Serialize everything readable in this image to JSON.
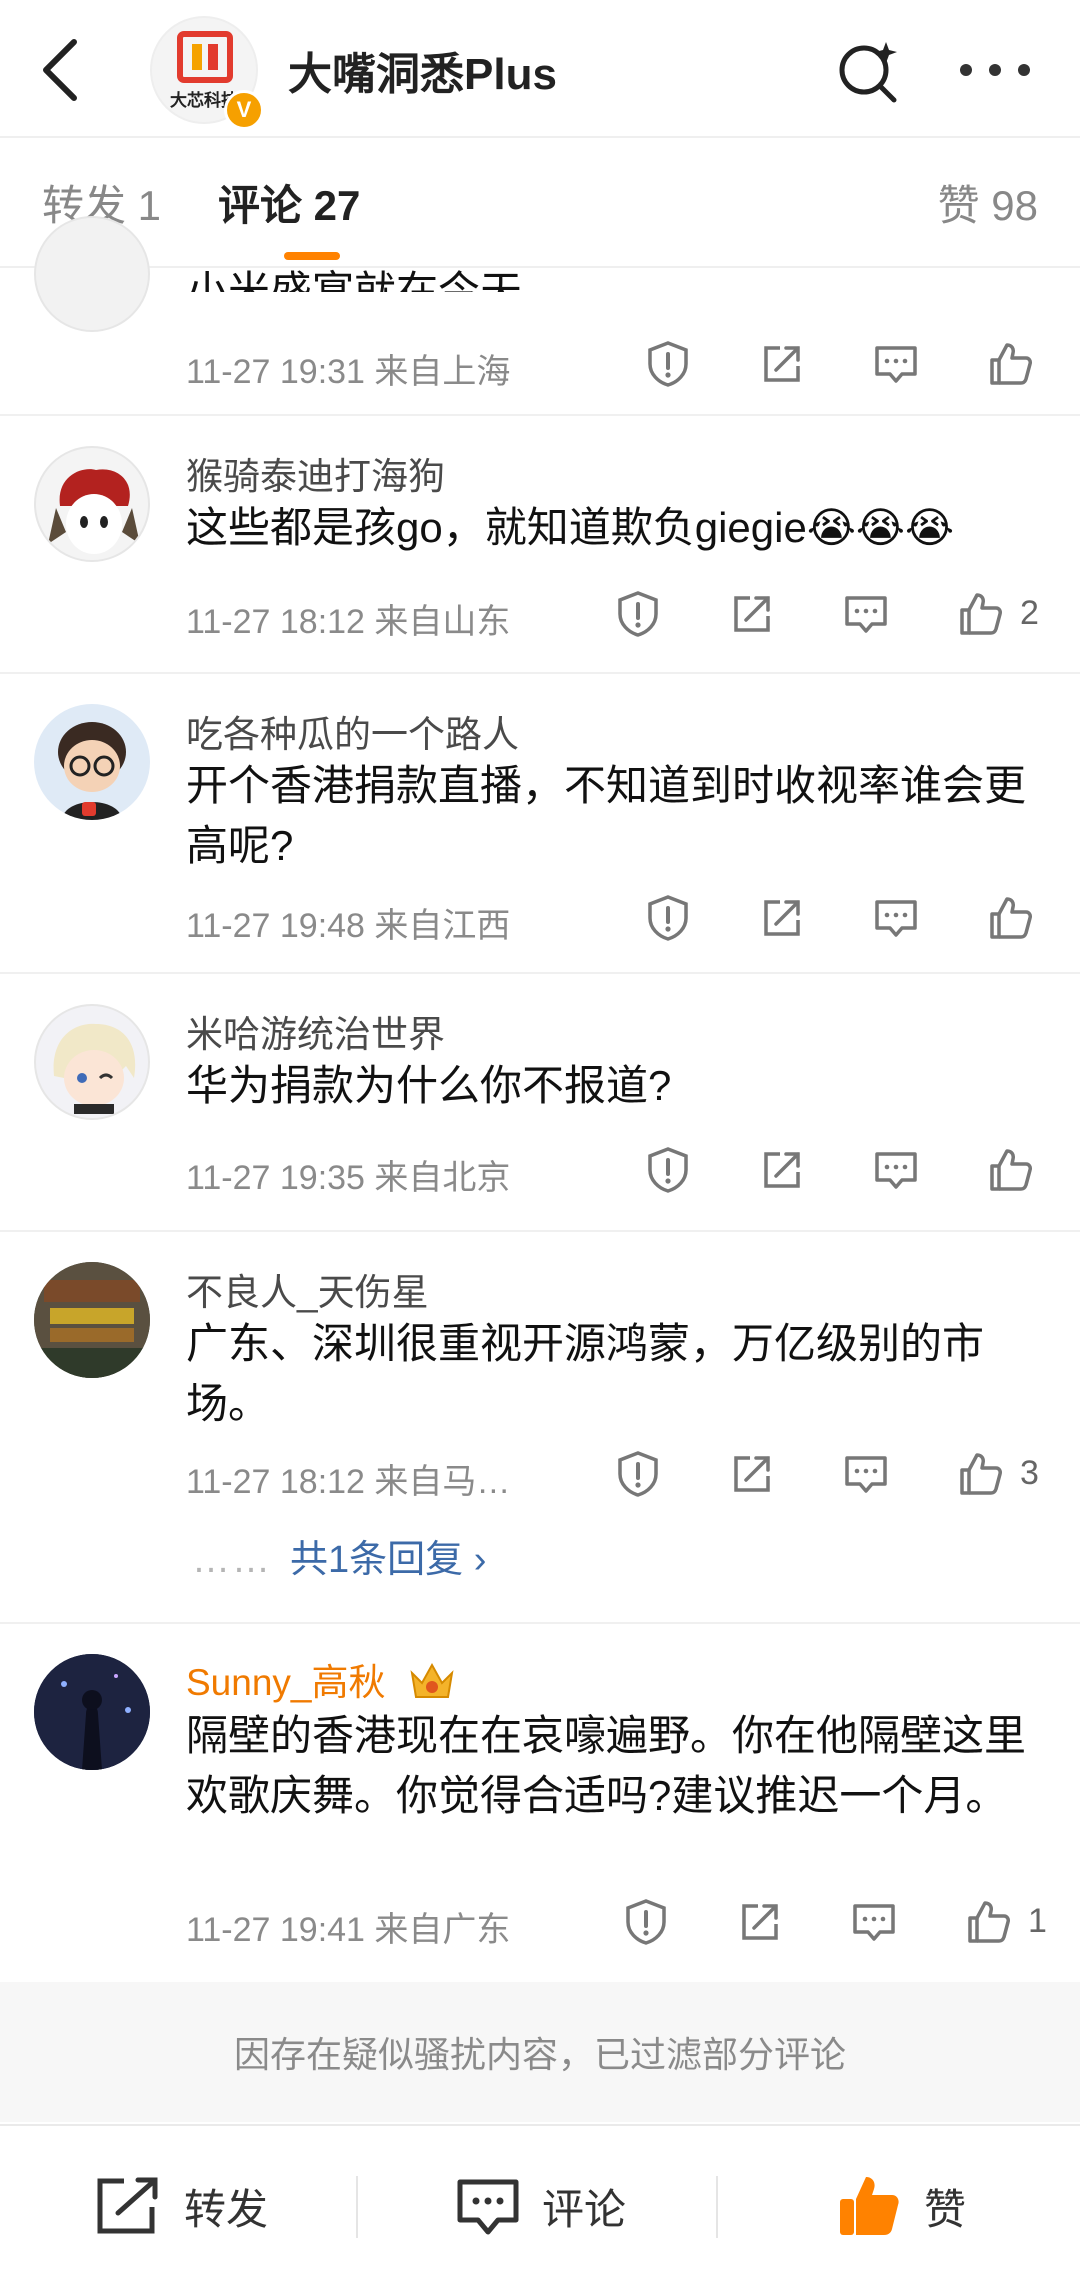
{
  "header": {
    "title": "大嘴洞悉Plus",
    "avatar_text": "大芯科技",
    "verified_mark": "V"
  },
  "tabs": {
    "repost": "转发 1",
    "comments": "评论 27",
    "likes": "赞 98"
  },
  "comments": [
    {
      "text": "小米盛宴就在今天",
      "meta": "11-27 19:31  来自上海",
      "likes": ""
    },
    {
      "username": "猴骑泰迪打海狗",
      "text": "这些都是孩go，就知道欺负giegie😭😭😭",
      "meta": "11-27 18:12  来自山东",
      "likes": "2"
    },
    {
      "username": "吃各种瓜的一个路人",
      "text": "开个香港捐款直播，不知道到时收视率谁会更高呢?",
      "meta": "11-27 19:48  来自江西",
      "likes": ""
    },
    {
      "username": "米哈游统治世界",
      "text": "华为捐款为什么你不报道?",
      "meta": "11-27 19:35  来自北京",
      "likes": ""
    },
    {
      "username": "不良人_天伤星",
      "text": "广东、深圳很重视开源鸿蒙，万亿级别的市场。",
      "meta": "11-27 18:12  来自马…",
      "likes": "3",
      "replies": "共1条回复 ›"
    },
    {
      "username": "Sunny_高秋",
      "text": "隔壁的香港现在在哀嚎遍野。你在他隔壁这里欢歌庆舞。你觉得合适吗?建议推迟一个月。",
      "meta": "11-27 19:41  来自广东",
      "likes": "1"
    }
  ],
  "filter_notice": "因存在疑似骚扰内容，已过滤部分评论",
  "bottom_bar": {
    "repost": "转发",
    "comment": "评论",
    "like": "赞"
  },
  "colors": {
    "accent": "#ff8200",
    "link": "#3c6aa8",
    "vip_name": "#f07a00"
  }
}
